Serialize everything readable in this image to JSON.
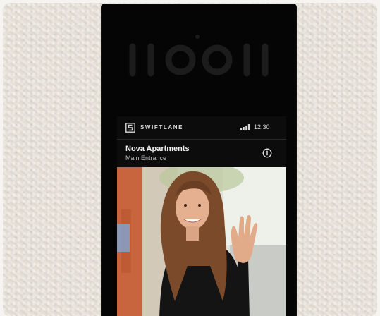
{
  "device": {
    "brand": "SWIFTLANE",
    "time": "12:30",
    "property_name": "Nova Apartments",
    "entrance_name": "Main Entrance"
  },
  "icons": {
    "logo": "swiftlane-logo-icon",
    "signal": "signal-strength-icon",
    "info": "info-icon"
  },
  "colors": {
    "device_body": "#050505",
    "screen_bg": "#0c0c0c",
    "wall": "#e6e0d8"
  }
}
